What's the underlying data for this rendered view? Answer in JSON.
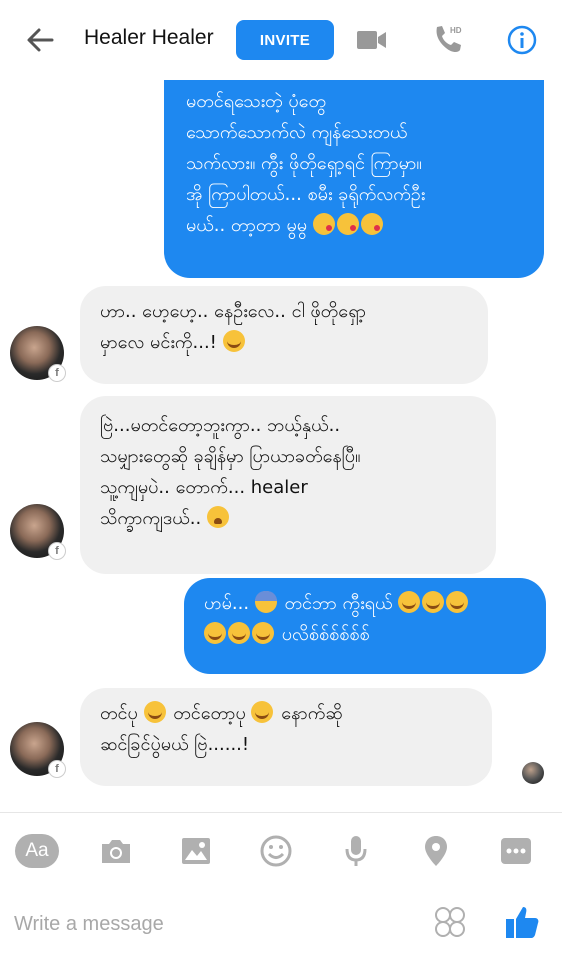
{
  "header": {
    "title": "Healer Healer",
    "invite_label": "INVITE",
    "back_icon": "arrow-left-icon",
    "video_icon": "video-camera-icon",
    "call_icon": "phone-hd-icon",
    "call_badge": "HD",
    "info_icon": "info-icon"
  },
  "colors": {
    "accent": "#1e88f0",
    "incoming_bubble": "#f0f0f0",
    "toolbar_icon": "#b0b0b0"
  },
  "messages": [
    {
      "direction": "outgoing",
      "lines": [
        "မတင်ရသေးတဲ့ ပုံတွေ",
        "သောက်သောက်လဲ ကျန်သေးတယ်",
        "သက်လား။ ကွီး ဖိုတိုရှော့ရင် ကြာမှာ။",
        "အို ကြာပါတယ်... စမီး ခုရိုက်လက်ဦး",
        "မယ်.. တာ့တာ မွမွ"
      ],
      "emojis": [
        "kiss",
        "kiss",
        "kiss"
      ]
    },
    {
      "direction": "incoming",
      "lines": [
        "ဟာ.. ဟေ့ဟေ့.. နေဦးလေ.. ငါ ဖိုတိုရှော့",
        "မှာလေ မင်းကို...!"
      ],
      "emojis": [
        "cry"
      ]
    },
    {
      "direction": "incoming",
      "lines": [
        "ဗြဲ...မတင်တော့ဘူးကွာ.. ဘယ့်နှယ်..",
        "သမျှားတွေဆို ခုချိန်မှာ ပြာယာခတ်နေပြီ။",
        "သူ့ကျမှပဲ.. တောက်... healer",
        "သိက္ခာကျဒယ်.."
      ],
      "emojis": [
        "weary"
      ]
    },
    {
      "direction": "outgoing",
      "lines": [
        "ဟမ်...",
        "တင်ဘာ ကွီးရယ်",
        "ပလိစ်စ်စ်စ်စ်စ်"
      ],
      "emojis": [
        "fear",
        "cry",
        "cry",
        "cry",
        "cry",
        "cry",
        "cry"
      ]
    },
    {
      "direction": "incoming",
      "lines": [
        "တင်ပု",
        "တင်တော့ပု",
        "နောက်ဆို",
        "ဆင်ခြင်ပွဲမယ် ဗြဲ......!"
      ],
      "emojis": [
        "cry",
        "cry"
      ]
    }
  ],
  "avatar_badge": "f",
  "toolbar": [
    {
      "name": "text-style-icon",
      "label": "Aa"
    },
    {
      "name": "camera-icon"
    },
    {
      "name": "gallery-icon"
    },
    {
      "name": "emoji-icon"
    },
    {
      "name": "microphone-icon"
    },
    {
      "name": "location-icon"
    },
    {
      "name": "more-icon"
    }
  ],
  "composer": {
    "placeholder": "Write a message",
    "sticker_icon": "sticker-icon",
    "like_icon": "thumbs-up-icon"
  }
}
